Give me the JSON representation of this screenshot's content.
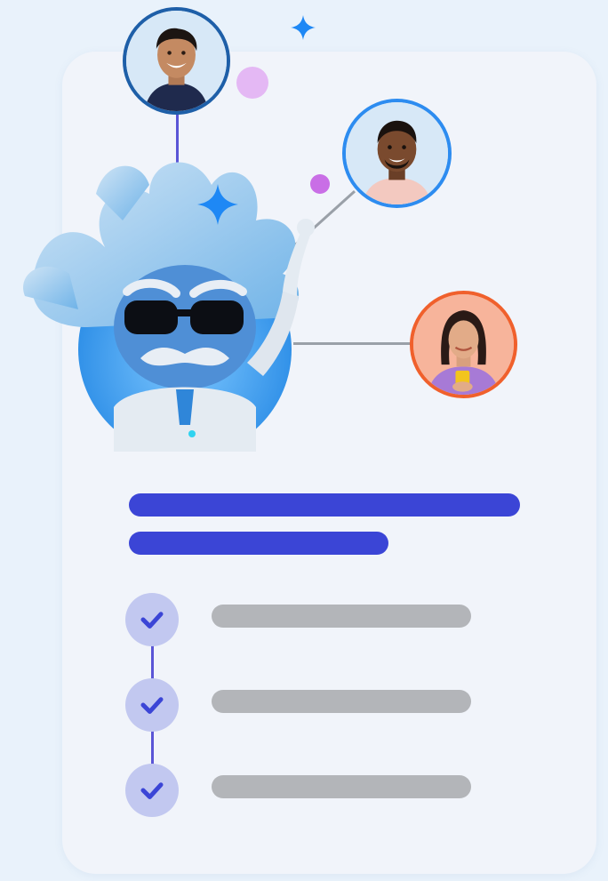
{
  "illustration": {
    "avatars": [
      {
        "name": "person-1",
        "ring_color": "#1e5fa8"
      },
      {
        "name": "person-2",
        "ring_color": "#2d8cf0"
      },
      {
        "name": "person-3",
        "ring_color": "#f0602c"
      }
    ],
    "mascot": {
      "name": "ai-mascot-with-sunglasses"
    },
    "checklist": {
      "items": [
        {
          "checked": true
        },
        {
          "checked": true
        },
        {
          "checked": true
        }
      ]
    },
    "colors": {
      "background": "#e9f2fb",
      "card": "#f1f4fa",
      "accent_blue": "#3b45d6",
      "placeholder_grey": "#b3b5b9",
      "check_bg": "#c2c8f0",
      "sparkle_blue": "#1e88f5",
      "dot_purple": "#c073e8"
    }
  }
}
